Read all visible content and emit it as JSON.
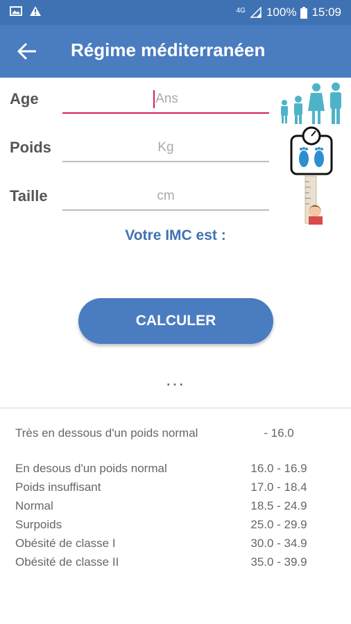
{
  "status_bar": {
    "network": "4G",
    "battery": "100%",
    "time": "15:09"
  },
  "app_bar": {
    "title": "Régime méditerranéen"
  },
  "form": {
    "age_label": "Age",
    "age_placeholder": "Ans",
    "weight_label": "Poids",
    "weight_placeholder": "Kg",
    "height_label": "Taille",
    "height_placeholder": "cm"
  },
  "result_label": "Votre IMC est :",
  "calculate_button": "CALCULER",
  "more_indicator": "...",
  "bmi_table": [
    {
      "category": "Très en dessous d'un poids normal",
      "range": "- 16.0"
    },
    {
      "category": "En desous d'un poids normal",
      "range": "16.0 - 16.9"
    },
    {
      "category": "Poids insuffisant",
      "range": "17.0 - 18.4"
    },
    {
      "category": "Normal",
      "range": "18.5 - 24.9"
    },
    {
      "category": "Surpoids",
      "range": "25.0 - 29.9"
    },
    {
      "category": "Obésité de classe I",
      "range": "30.0 - 34.9"
    },
    {
      "category": "Obésité de classe II",
      "range": "35.0 - 39.9"
    }
  ],
  "colors": {
    "primary": "#4a7cc0",
    "accent": "#d81b60",
    "people_icon": "#4fb3c8"
  }
}
